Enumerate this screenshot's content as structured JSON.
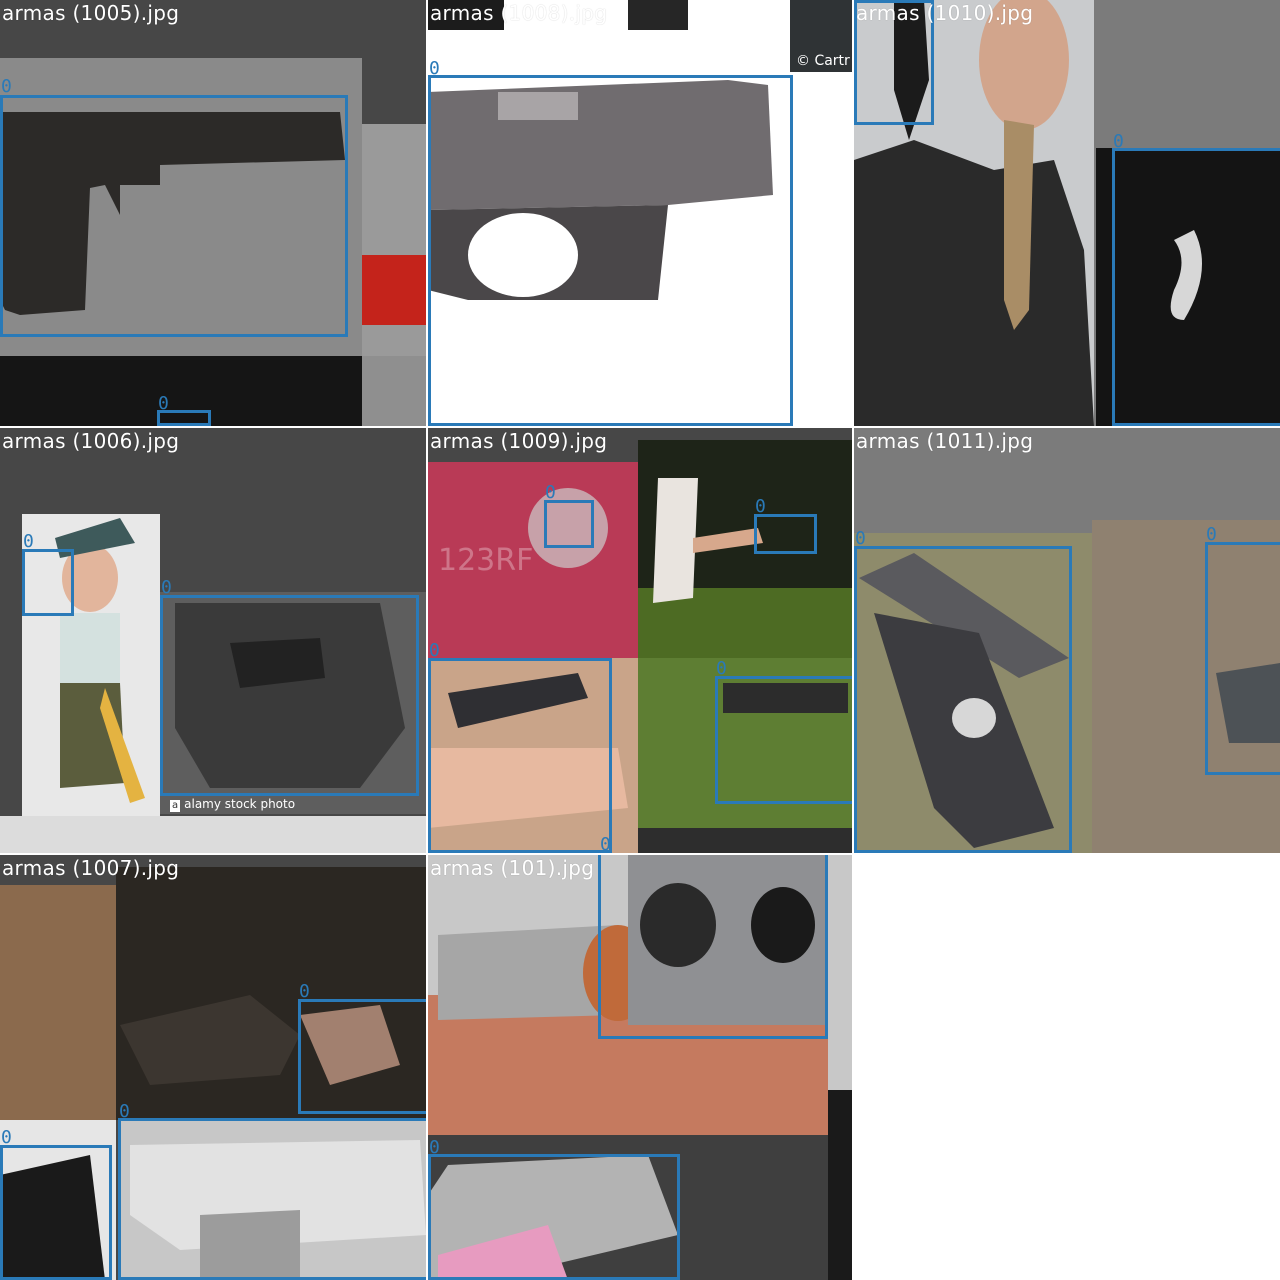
{
  "colors": {
    "box": "#2a7ab8",
    "label": "#2a7ab8",
    "header_dark": "#474747",
    "header_gray": "#7b7b7b"
  },
  "tiles": [
    {
      "name": "armas (1005).jpg",
      "labels": [
        "0",
        "0"
      ]
    },
    {
      "name": "armas (1008).jpg",
      "labels": [
        "0"
      ],
      "copyright": "© Cartr"
    },
    {
      "name": "armas (1010).jpg",
      "labels": [
        "0"
      ]
    },
    {
      "name": "armas (1006).jpg",
      "labels": [
        "0",
        "0"
      ],
      "stock_text": "alamy stock photo",
      "stock_icon": "a"
    },
    {
      "name": "armas (1009).jpg",
      "labels": [
        "0",
        "0",
        "0",
        "0",
        "0"
      ],
      "watermark": "123RF"
    },
    {
      "name": "armas (1011).jpg",
      "labels": [
        "0",
        "0"
      ]
    },
    {
      "name": "armas (1007).jpg",
      "labels": [
        "0",
        "0",
        "0"
      ]
    },
    {
      "name": "armas (101).jpg",
      "labels": [
        "0",
        "0"
      ]
    }
  ]
}
